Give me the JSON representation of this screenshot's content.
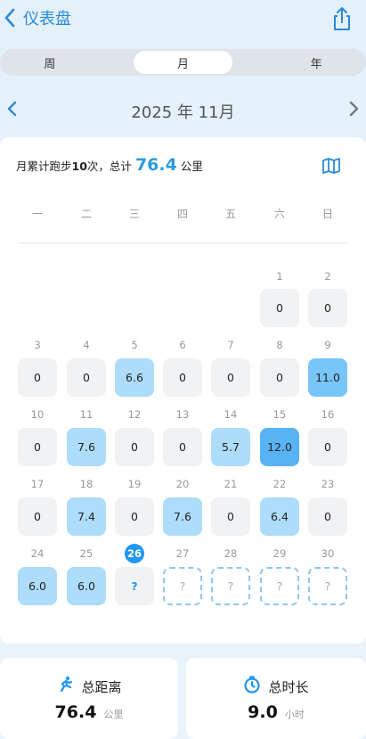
{
  "header": {
    "title": "仪表盘",
    "back_icon": "chevron-left-icon",
    "share_icon": "share-icon"
  },
  "tabs": [
    {
      "label": "周",
      "active": false
    },
    {
      "label": "月",
      "active": true
    },
    {
      "label": "年",
      "active": false
    }
  ],
  "month_nav": {
    "label": "2025 年 11月"
  },
  "summary": {
    "prefix": "月累计跑步",
    "count": "10",
    "count_suffix": "次，总计",
    "total": "76.4",
    "unit": "公里"
  },
  "weekdays": [
    "一",
    "二",
    "三",
    "四",
    "五",
    "六",
    "日"
  ],
  "calendar": {
    "today": "26",
    "weeks": [
      [
        null,
        null,
        null,
        null,
        null,
        {
          "day": "1",
          "value": "0",
          "level": "zero"
        },
        {
          "day": "2",
          "value": "0",
          "level": "zero"
        }
      ],
      [
        {
          "day": "3",
          "value": "0",
          "level": "zero"
        },
        {
          "day": "4",
          "value": "0",
          "level": "zero"
        },
        {
          "day": "5",
          "value": "6.6",
          "level": "l1"
        },
        {
          "day": "6",
          "value": "0",
          "level": "zero"
        },
        {
          "day": "7",
          "value": "0",
          "level": "zero"
        },
        {
          "day": "8",
          "value": "0",
          "level": "zero"
        },
        {
          "day": "9",
          "value": "11.0",
          "level": "l2"
        }
      ],
      [
        {
          "day": "10",
          "value": "0",
          "level": "zero"
        },
        {
          "day": "11",
          "value": "7.6",
          "level": "l1"
        },
        {
          "day": "12",
          "value": "0",
          "level": "zero"
        },
        {
          "day": "13",
          "value": "0",
          "level": "zero"
        },
        {
          "day": "14",
          "value": "5.7",
          "level": "l1"
        },
        {
          "day": "15",
          "value": "12.0",
          "level": "l3"
        },
        {
          "day": "16",
          "value": "0",
          "level": "zero"
        }
      ],
      [
        {
          "day": "17",
          "value": "0",
          "level": "zero"
        },
        {
          "day": "18",
          "value": "7.4",
          "level": "l1"
        },
        {
          "day": "19",
          "value": "0",
          "level": "zero"
        },
        {
          "day": "20",
          "value": "7.6",
          "level": "l1"
        },
        {
          "day": "21",
          "value": "0",
          "level": "zero"
        },
        {
          "day": "22",
          "value": "6.4",
          "level": "l1"
        },
        {
          "day": "23",
          "value": "0",
          "level": "zero"
        }
      ],
      [
        {
          "day": "24",
          "value": "6.0",
          "level": "l1"
        },
        {
          "day": "25",
          "value": "6.0",
          "level": "l1"
        },
        {
          "day": "26",
          "value": "?",
          "level": "unknown-today"
        },
        {
          "day": "27",
          "value": "?",
          "level": "future"
        },
        {
          "day": "28",
          "value": "?",
          "level": "future"
        },
        {
          "day": "29",
          "value": "?",
          "level": "future"
        },
        {
          "day": "30",
          "value": "?",
          "level": "future"
        }
      ]
    ]
  },
  "stats": {
    "distance": {
      "label": "总距离",
      "value": "76.4",
      "unit": "公里",
      "icon": "running-icon"
    },
    "duration": {
      "label": "总时长",
      "value": "9.0",
      "unit": "小时",
      "icon": "timer-icon"
    }
  },
  "colors": {
    "accent": "#2196f3",
    "zero": "#f1f2f4",
    "light": "#aedcfb",
    "mid": "#78c5f8",
    "dark": "#58b3f4"
  }
}
